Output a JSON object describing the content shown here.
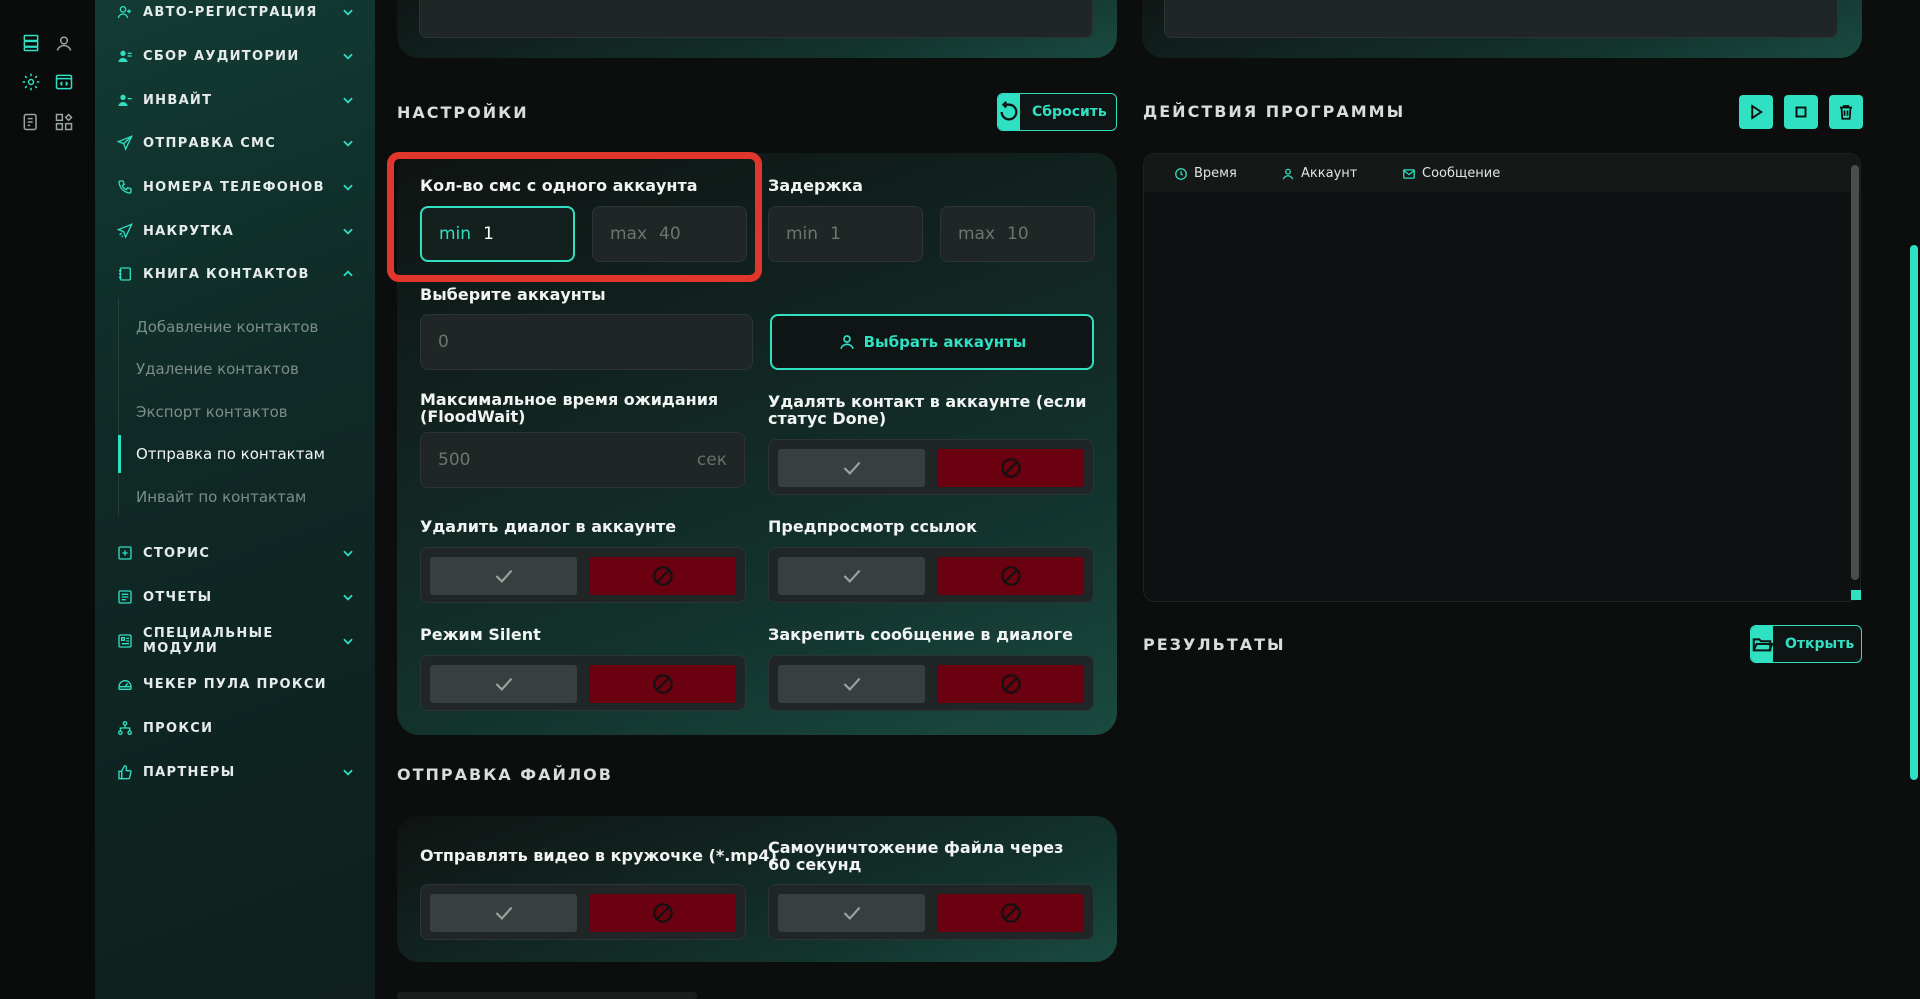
{
  "colors": {
    "accent": "#2fe0c2",
    "danger": "#6b0010",
    "highlight": "#e0362c"
  },
  "sidebar": {
    "items": [
      {
        "label": "АВТО-РЕГИСТРАЦИЯ",
        "icon": "user-plus-icon",
        "expandable": true
      },
      {
        "label": "СБОР АУДИТОРИИ",
        "icon": "users-icon",
        "expandable": true
      },
      {
        "label": "ИНВАЙТ",
        "icon": "users-icon",
        "expandable": true
      },
      {
        "label": "ОТПРАВКА СМС",
        "icon": "send-icon",
        "expandable": true
      },
      {
        "label": "НОМЕРА ТЕЛЕФОНОВ",
        "icon": "phone-icon",
        "expandable": true
      },
      {
        "label": "НАКРУТКА",
        "icon": "send-boost-icon",
        "expandable": true
      },
      {
        "label": "КНИГА КОНТАКТОВ",
        "icon": "book-icon",
        "expanded": true
      },
      {
        "label": "СТОРИС",
        "icon": "plus-square-icon",
        "expandable": true
      },
      {
        "label": "ОТЧЕТЫ",
        "icon": "report-icon",
        "expandable": true
      },
      {
        "label": "СПЕЦИАЛЬНЫЕ МОДУЛИ",
        "icon": "modules-icon",
        "expandable": true
      },
      {
        "label": "ЧЕКЕР ПУЛА ПРОКСИ",
        "icon": "gauge-icon",
        "expandable": false
      },
      {
        "label": "ПРОКСИ",
        "icon": "network-icon",
        "expandable": false
      },
      {
        "label": "ПАРТНЕРЫ",
        "icon": "thumb-up-icon",
        "expandable": true
      }
    ],
    "subitems": [
      "Добавление контактов",
      "Удаление контактов",
      "Экспорт контактов",
      "Отправка по контактам",
      "Инвайт по контактам"
    ],
    "active_subitem": "Отправка по контактам"
  },
  "settings": {
    "title": "НАСТРОЙКИ",
    "reset_label": "Сбросить",
    "sms_per_account": {
      "label": "Кол-во смс с одного аккаунта",
      "min_key": "min",
      "min_value": "1",
      "max_key": "max",
      "max_value": "40"
    },
    "delay": {
      "label": "Задержка",
      "min_key": "min",
      "min_value": "1",
      "max_key": "max",
      "max_value": "10"
    },
    "accounts": {
      "label": "Выберите аккаунты",
      "value": "0",
      "button": "Выбрать аккаунты"
    },
    "floodwait": {
      "label": "Максимальное время ожидания (FloodWait)",
      "value": "500",
      "unit": "сек"
    },
    "delete_contact": {
      "label": "Удалять контакт в аккаунте (если статус Done)"
    },
    "delete_dialog": {
      "label": "Удалить диалог в аккаунте"
    },
    "link_preview": {
      "label": "Предпросмотр ссылок"
    },
    "silent": {
      "label": "Режим Silent"
    },
    "pin_message": {
      "label": "Закрепить сообщение в диалоге"
    }
  },
  "files": {
    "title": "ОТПРАВКА ФАЙЛОВ",
    "video_circle": {
      "label": "Отправлять видео в кружочке (*.mp4)"
    },
    "self_destruct": {
      "label": "Самоуничтожение файла через 60 секунд"
    }
  },
  "actions": {
    "title": "ДЕЙСТВИЯ ПРОГРАММЫ",
    "columns": [
      "Время",
      "Аккаунт",
      "Сообщение"
    ]
  },
  "results": {
    "title": "РЕЗУЛЬТАТЫ",
    "open_label": "Открыть"
  }
}
